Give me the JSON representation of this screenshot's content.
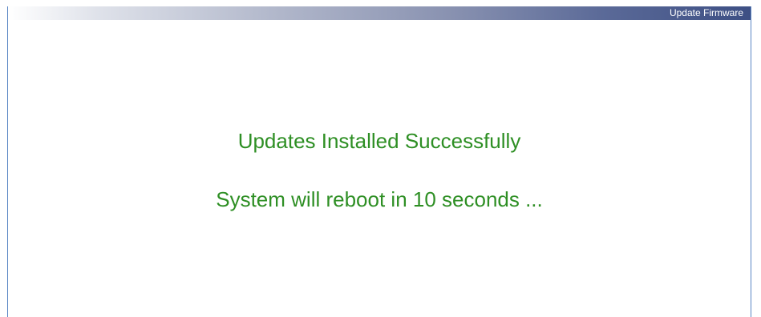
{
  "window": {
    "title": "Update Firmware"
  },
  "status": {
    "headline": "Updates Installed Successfully",
    "reboot_notice": "System will reboot in 10 seconds ..."
  },
  "colors": {
    "message_green": "#2e8f24",
    "title_bar_dark": "#3d4f84",
    "frame_border": "#5a86c4"
  }
}
